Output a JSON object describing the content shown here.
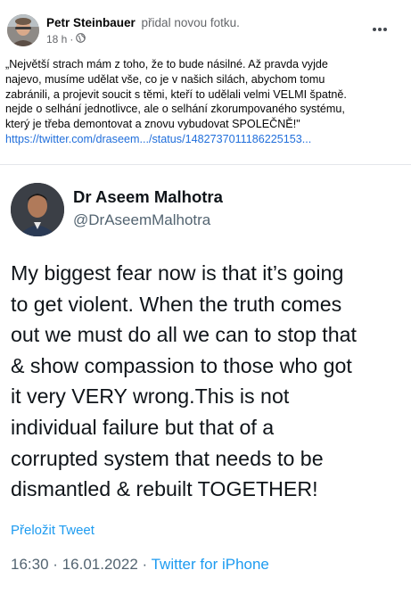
{
  "post": {
    "author": "Petr Steinbauer",
    "action": "přidal novou fotku.",
    "time": "18 h",
    "separator": "·",
    "privacy_icon": "globe-icon",
    "more_icon": "more-horizontal-icon",
    "text_lines": [
      "„Největší strach mám z toho, že to bude násilné. Až pravda vyjde",
      "najevo, musíme udělat vše, co je v našich silách, abychom tomu",
      "zabránili, a projevit soucit s těmi, kteří to udělali velmi VELMI špatně.",
      "nejde o selhání jednotlivce, ale o selhání zkorumpovaného systému,",
      "který je třeba demontovat a znovu vybudovat SPOLEČNĚ!\""
    ],
    "link": "https://twitter.com/draseem.../status/1482737011186225153..."
  },
  "tweet": {
    "name": "Dr Aseem Malhotra",
    "handle": "@DrAseemMalhotra",
    "body_lines": [
      "My biggest fear now is that it’s going",
      "to get violent. When the truth comes",
      "out we must do all we can to stop that",
      "& show compassion to those who got",
      "it very VERY wrong.This is not",
      "individual failure but that of a",
      "corrupted system that needs to be",
      "dismantled & rebuilt TOGETHER!"
    ],
    "translate": "Přeložit Tweet",
    "time": "16:30",
    "dot": "·",
    "date": "16.01.2022",
    "source": "Twitter for iPhone"
  },
  "colors": {
    "fb_link": "#216fdb",
    "twitter_blue": "#1d9bf0",
    "secondary_text": "#65676b"
  }
}
